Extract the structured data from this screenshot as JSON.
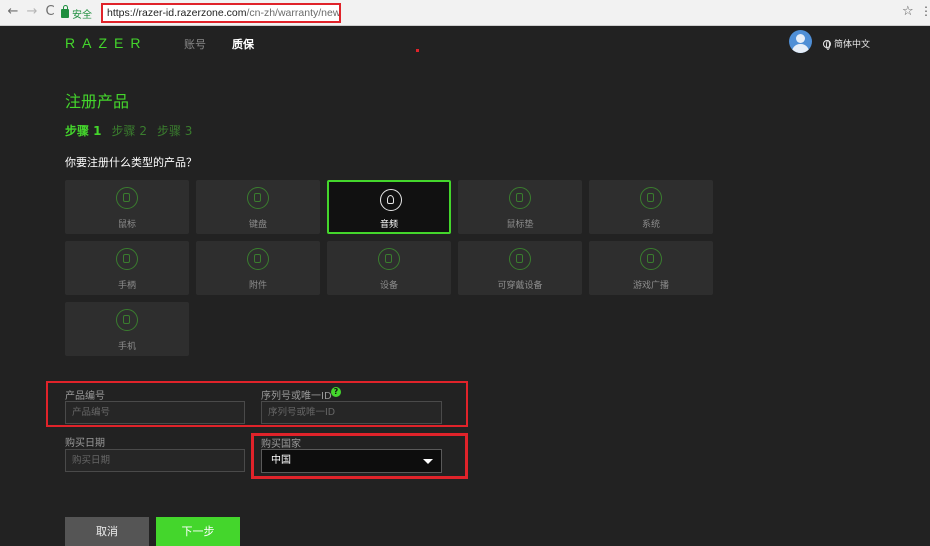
{
  "browser": {
    "back": "←",
    "forward": "→",
    "reload": "C",
    "secure_label": "安全",
    "url_host": "https://razer-id.razerzone.com",
    "url_path": "/cn-zh/warranty/new",
    "star": "☆",
    "menu": "⋮"
  },
  "header": {
    "logo": "RAZER",
    "nav": [
      "账号",
      "质保"
    ],
    "language": "简体中文"
  },
  "page": {
    "title": "注册产品",
    "steps": [
      "步骤 1",
      "步骤 2",
      "步骤 3"
    ],
    "question": "你要注册什么类型的产品？"
  },
  "product_types": [
    {
      "label": "鼠标",
      "icon": "mouse-icon"
    },
    {
      "label": "键盘",
      "icon": "keyboard-icon"
    },
    {
      "label": "音频",
      "icon": "headset-icon",
      "selected": true
    },
    {
      "label": "鼠标垫",
      "icon": "mousepad-icon"
    },
    {
      "label": "系统",
      "icon": "laptop-icon"
    },
    {
      "label": "手柄",
      "icon": "gamepad-icon"
    },
    {
      "label": "附件",
      "icon": "accessory-icon"
    },
    {
      "label": "设备",
      "icon": "device-icon"
    },
    {
      "label": "可穿戴设备",
      "icon": "wearable-icon"
    },
    {
      "label": "游戏广播",
      "icon": "broadcast-icon"
    },
    {
      "label": "手机",
      "icon": "phone-icon"
    }
  ],
  "form": {
    "product_number_label": "产品编号",
    "product_number_placeholder": "产品编号",
    "serial_label": "序列号或唯一ID",
    "serial_placeholder": "序列号或唯一ID",
    "help": "?",
    "purchase_date_label": "购买日期",
    "purchase_date_placeholder": "购买日期",
    "country_label": "购买国家",
    "country_value": "中国"
  },
  "buttons": {
    "cancel": "取消",
    "next": "下一步"
  },
  "colors": {
    "accent": "#44d62c",
    "background": "#222222",
    "annotation": "#e0232a"
  }
}
